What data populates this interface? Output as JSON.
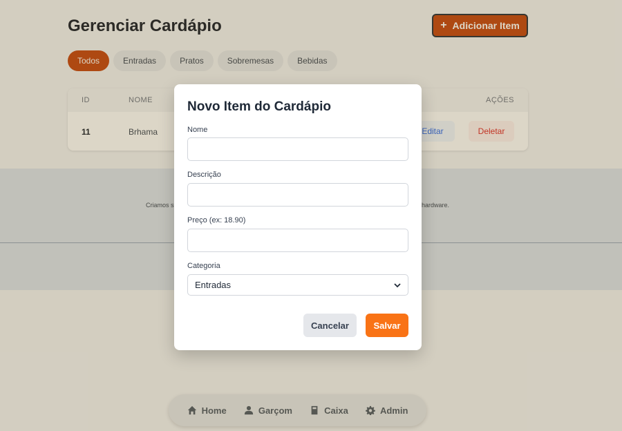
{
  "page": {
    "title": "Gerenciar Cardápio",
    "add_button_label": "Adicionar Item",
    "filters": [
      "Todos",
      "Entradas",
      "Pratos",
      "Sobremesas",
      "Bebidas"
    ],
    "active_filter": "Todos",
    "table": {
      "headers": {
        "id": "ID",
        "nome": "NOME",
        "acoes": "AÇÕES"
      },
      "rows": [
        {
          "id": "11",
          "nome": "Brhama",
          "edit_label": "Editar",
          "delete_label": "Deletar"
        }
      ]
    },
    "footer": {
      "text_left": "Criamos s",
      "text_right": "hardware."
    }
  },
  "bottom_nav": {
    "items": [
      {
        "label": "Home",
        "icon": "home-icon"
      },
      {
        "label": "Garçom",
        "icon": "user-icon"
      },
      {
        "label": "Caixa",
        "icon": "cash-register-icon"
      },
      {
        "label": "Admin",
        "icon": "gear-icon"
      }
    ]
  },
  "modal": {
    "title": "Novo Item do Cardápio",
    "fields": {
      "nome": {
        "label": "Nome",
        "value": ""
      },
      "descricao": {
        "label": "Descrição",
        "value": ""
      },
      "preco": {
        "label": "Preço (ex: 18.90)",
        "value": ""
      },
      "categoria": {
        "label": "Categoria",
        "value": "Entradas"
      }
    },
    "cancel_label": "Cancelar",
    "save_label": "Salvar"
  },
  "colors": {
    "accent": "#c2410c",
    "save": "#f97316",
    "edit": "#2563eb",
    "delete": "#dc2626"
  }
}
